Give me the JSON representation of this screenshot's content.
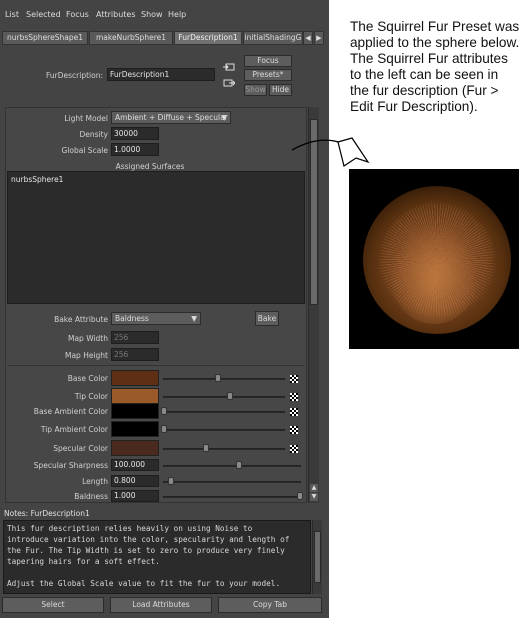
{
  "menu": [
    "List",
    "Selected",
    "Focus",
    "Attributes",
    "Show",
    "Help"
  ],
  "tabs": [
    "nurbsSphereShape1",
    "makeNurbSphere1",
    "FurDescription1",
    "initialShadingG"
  ],
  "active_tab": "FurDescription1",
  "header": {
    "fur_description_label": "FurDescription:",
    "fur_description_value": "FurDescription1",
    "focus": "Focus",
    "presets": "Presets*",
    "show": "Show",
    "hide": "Hide"
  },
  "attributes": {
    "light_model_label": "Light Model",
    "light_model_value": "Ambient + Diffuse + Specular",
    "density_label": "Density",
    "density_value": "30000",
    "global_scale_label": "Global Scale",
    "global_scale_value": "1.0000",
    "assigned_surfaces_label": "Assigned Surfaces",
    "assigned_surface_item": "nurbsSphere1",
    "bake_attribute_label": "Bake Attribute",
    "bake_attribute_value": "Baldness",
    "bake_button": "Bake",
    "map_width_label": "Map Width",
    "map_width_value": "256",
    "map_height_label": "Map Height",
    "map_height_value": "256"
  },
  "colors": [
    {
      "label": "Base Color",
      "swatch": "#5e2f14",
      "level": 0.45
    },
    {
      "label": "Tip Color",
      "swatch": "#9a5a2a",
      "level": 0.55
    },
    {
      "label": "Base Ambient Color",
      "swatch": "#000000",
      "level": 0.0
    },
    {
      "label": "Tip Ambient Color",
      "swatch": "#000000",
      "level": 0.0
    },
    {
      "label": "Specular Color",
      "swatch": "#4a2a1e",
      "level": 0.35
    }
  ],
  "numeric": [
    {
      "label": "Specular Sharpness",
      "value": "100.000",
      "level": 0.55
    },
    {
      "label": "Length",
      "value": "0.800",
      "level": 0.05
    },
    {
      "label": "Baldness",
      "value": "1.000",
      "level": 1.0
    }
  ],
  "notes": {
    "title": "Notes: FurDescription1",
    "text": "This fur description relies heavily on using Noise to\nintroduce variation into the color, specularity and length of\nthe Fur. The Tip Width is set to zero to produce very finely\ntapering hairs for a soft effect.\n\nAdjust the Global Scale value to fit the fur to your model."
  },
  "bottom_buttons": [
    "Select",
    "Load Attributes",
    "Copy Tab"
  ],
  "caption": "The Squirrel Fur Preset was applied to the sphere below. The Squirrel Fur attributes to the left can be seen in the fur description (Fur > Edit Fur Description)."
}
